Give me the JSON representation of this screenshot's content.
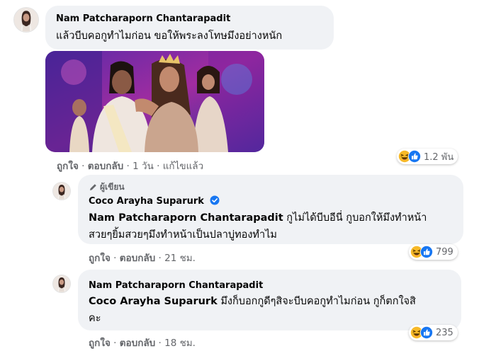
{
  "comment1": {
    "author": "Nam Patcharaporn Chantarapadit",
    "text": "แล้วบีบคอกูทำไมก่อน ขอให้พระลงโทษมึงอย่างหนัก",
    "actions": {
      "like": "ถูกใจ",
      "reply": "ตอบกลับ",
      "time": "1 วัน",
      "edited": "แก้ไขแล้ว"
    },
    "reactions": {
      "count": "1.2 พัน",
      "icons": [
        "haha-icon",
        "like-icon"
      ]
    }
  },
  "reply1": {
    "author_tag": "ผู้เขียน",
    "author": "Coco Arayha Suparurk",
    "mention": "Nam Patcharaporn Chantarapadit",
    "text_line1_rest": " กูไม่ได้บีบอีนี่ กูบอกให้มึงทำหน้า",
    "text_line2": "สวยๆยิ้มสวยๆมึงทำหน้าเป็นปลาบู่ทองทำไม",
    "actions": {
      "like": "ถูกใจ",
      "reply": "ตอบกลับ",
      "time": "21 ชม."
    },
    "reactions": {
      "count": "799",
      "icons": [
        "haha-icon",
        "like-icon"
      ]
    }
  },
  "reply2": {
    "author": "Nam Patcharaporn Chantarapadit",
    "mention": "Coco Arayha Suparurk",
    "text_line1_rest": " มึงก็บอกกูดีๆสิจะบีบคอกูทำไมก่อน กูก็ตกใจสิ",
    "text_line2": "คะ",
    "actions": {
      "like": "ถูกใจ",
      "reply": "ตอบกลับ",
      "time": "18 ชม."
    },
    "reactions": {
      "count": "235",
      "icons": [
        "haha-icon",
        "like-icon"
      ]
    }
  },
  "colors": {
    "bubble": "#f0f2f5",
    "meta": "#65676b",
    "like_blue": "#1877f2",
    "haha_yellow": "#f7b928"
  }
}
